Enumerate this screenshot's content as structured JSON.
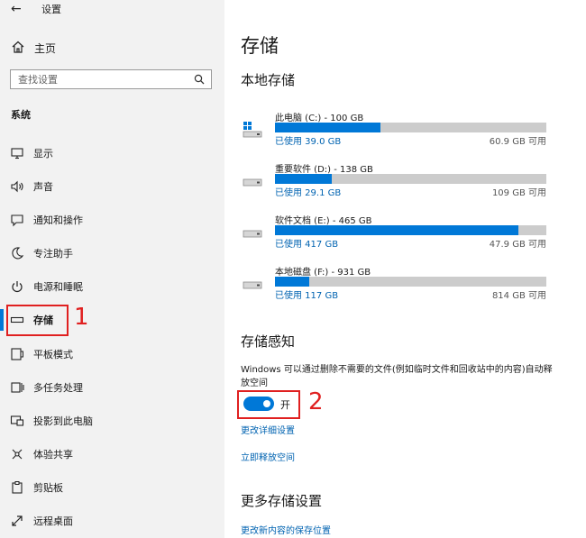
{
  "window": {
    "title": "设置",
    "back_glyph": "←"
  },
  "sidebar": {
    "home_label": "主页",
    "search_placeholder": "查找设置",
    "section_label": "系统",
    "items": [
      {
        "label": "显示",
        "icon": "monitor-icon"
      },
      {
        "label": "声音",
        "icon": "speaker-icon"
      },
      {
        "label": "通知和操作",
        "icon": "notification-icon"
      },
      {
        "label": "专注助手",
        "icon": "moon-icon"
      },
      {
        "label": "电源和睡眠",
        "icon": "power-icon"
      },
      {
        "label": "存储",
        "icon": "storage-icon",
        "active": true
      },
      {
        "label": "平板模式",
        "icon": "tablet-icon"
      },
      {
        "label": "多任务处理",
        "icon": "multitask-icon"
      },
      {
        "label": "投影到此电脑",
        "icon": "project-icon"
      },
      {
        "label": "体验共享",
        "icon": "share-icon"
      },
      {
        "label": "剪贴板",
        "icon": "clipboard-icon"
      },
      {
        "label": "远程桌面",
        "icon": "remote-icon"
      }
    ],
    "annotation": "1"
  },
  "main": {
    "title": "存储",
    "local_heading": "本地存储",
    "drives": [
      {
        "name": "此电脑 (C:) - 100 GB",
        "used": "已使用 39.0 GB",
        "free": "60.9 GB 可用",
        "used_fraction": 0.39,
        "icon": "system-drive-icon"
      },
      {
        "name": "重要软件 (D:) - 138 GB",
        "used": "已使用 29.1 GB",
        "free": "109 GB 可用",
        "used_fraction": 0.21,
        "icon": "drive-icon"
      },
      {
        "name": "软件文档 (E:) - 465 GB",
        "used": "已使用 417 GB",
        "free": "47.9 GB 可用",
        "used_fraction": 0.897,
        "icon": "drive-icon"
      },
      {
        "name": "本地磁盘 (F:) - 931 GB",
        "used": "已使用 117 GB",
        "free": "814 GB 可用",
        "used_fraction": 0.126,
        "icon": "drive-icon"
      }
    ],
    "sense_heading": "存储感知",
    "sense_desc": "Windows 可以通过删除不需要的文件(例如临时文件和回收站中的内容)自动释放空间",
    "toggle_label": "开",
    "toggle_on": true,
    "annotation": "2",
    "link_configure": "更改详细设置",
    "link_free_now": "立即释放空间",
    "more_heading": "更多存储设置",
    "link_save_location": "更改新内容的保存位置"
  },
  "colors": {
    "accent": "#0078d7",
    "annotation": "#e02020",
    "link": "#0063b1"
  }
}
